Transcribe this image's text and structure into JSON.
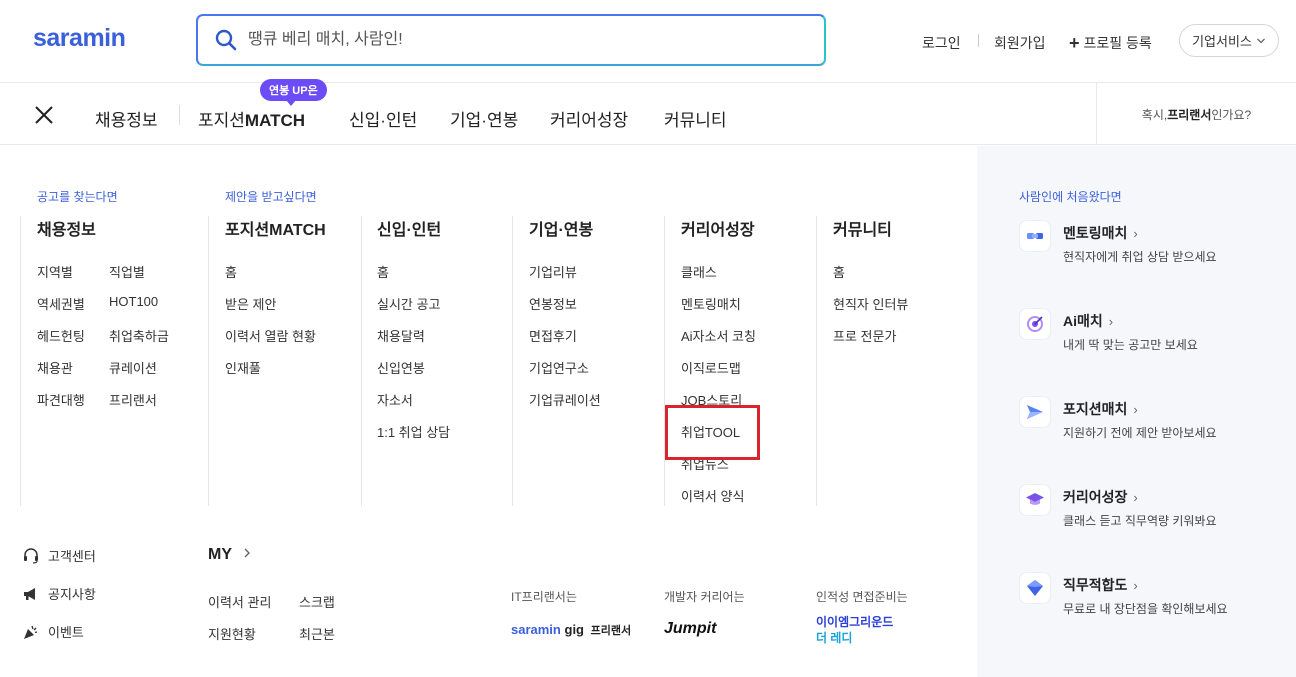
{
  "header": {
    "logo": "saramin",
    "search_placeholder": "땡큐 베리 매치, 사람인!",
    "login": "로그인",
    "signup": "회원가입",
    "profile": "프로필 등록",
    "biz_service": "기업서비스"
  },
  "nav": {
    "items": [
      "채용정보",
      "포지션",
      "MATCH",
      "신입·인턴",
      "기업·연봉",
      "커리어성장",
      "커뮤니티"
    ],
    "badge": "연봉 UP은",
    "freelancer_prefix": "혹시,",
    "freelancer_bold": "프리랜서",
    "freelancer_suffix": "인가요?"
  },
  "menu": {
    "section_find": "공고를 찾는다면",
    "section_offer": "제안을 받고싶다면",
    "columns": [
      {
        "title": "채용정보",
        "links": [
          "지역별",
          "직업별",
          "역세권별",
          "HOT100",
          "헤드헌팅",
          "취업축하금",
          "채용관",
          "큐레이션",
          "파견대행",
          "프리랜서"
        ]
      },
      {
        "title": "포지션MATCH",
        "links": [
          "홈",
          "받은 제안",
          "이력서 열람 현황",
          "인재풀"
        ]
      },
      {
        "title": "신입·인턴",
        "links": [
          "홈",
          "실시간 공고",
          "채용달력",
          "신입연봉",
          "자소서",
          "1:1 취업 상담"
        ]
      },
      {
        "title": "기업·연봉",
        "links": [
          "기업리뷰",
          "연봉정보",
          "면접후기",
          "기업연구소",
          "기업큐레이션"
        ]
      },
      {
        "title": "커리어성장",
        "links": [
          "클래스",
          "멘토링매치",
          "Ai자소서 코칭",
          "이직로드맵",
          "JOB스토리",
          "취업TOOL",
          "취업뉴스",
          "이력서 양식"
        ]
      },
      {
        "title": "커뮤니티",
        "links": [
          "홈",
          "현직자 인터뷰",
          "프로 전문가"
        ]
      }
    ]
  },
  "bottom": {
    "help": [
      "고객센터",
      "공지사항",
      "이벤트"
    ],
    "my_title": "MY",
    "my_links": [
      "이력서 관리",
      "스크랩",
      "지원현황",
      "최근본"
    ],
    "promos": [
      {
        "label": "IT프리랜서는",
        "logo_a": "saramin",
        "logo_b": "gig",
        "logo_c": "프리랜서"
      },
      {
        "label": "개발자 커리어는",
        "logo_a": "Jumpit"
      },
      {
        "label": "인적성 면접준비는",
        "logo_a": "이이엠그리운드",
        "logo_b": "더 레디"
      }
    ]
  },
  "right_panel": {
    "label": "사람인에 처음왔다면",
    "items": [
      {
        "title": "멘토링매치",
        "desc": "현직자에게 취업 상담 받으세요",
        "icon": "handshake-icon"
      },
      {
        "title": "Ai매치",
        "desc": "내게 딱 맞는 공고만 보세요",
        "icon": "target-icon"
      },
      {
        "title": "포지션매치",
        "desc": "지원하기 전에 제안 받아보세요",
        "icon": "paper-plane-icon"
      },
      {
        "title": "커리어성장",
        "desc": "클래스 듣고 직무역량 키워봐요",
        "icon": "graduation-cap-icon"
      },
      {
        "title": "직무적합도",
        "desc": "무료로 내 장단점을 확인해보세요",
        "icon": "gem-icon"
      }
    ]
  },
  "colors": {
    "brand_blue": "#3b5fd9",
    "badge_purple": "#6b4cf6",
    "highlight_red": "#d9232d"
  }
}
